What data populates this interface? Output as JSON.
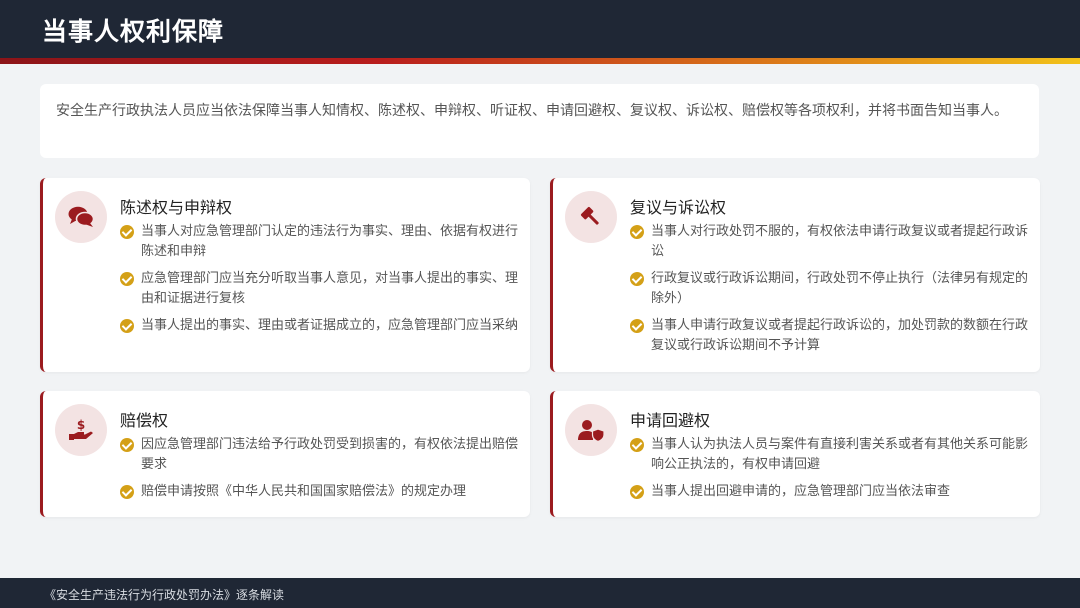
{
  "header": {
    "title": "当事人权利保障"
  },
  "intro": {
    "text": "安全生产行政执法人员应当依法保障当事人知情权、陈述权、申辩权、听证权、申请回避权、复议权、诉讼权、赔偿权等各项权利，并将书面告知当事人。"
  },
  "cards": [
    {
      "icon": "chat-bubbles-icon",
      "title": "陈述权与申辩权",
      "items": [
        "当事人对应急管理部门认定的违法行为事实、理由、依据有权进行陈述和申辩",
        "应急管理部门应当充分听取当事人意见，对当事人提出的事实、理由和证据进行复核",
        "当事人提出的事实、理由或者证据成立的，应急管理部门应当采纳"
      ]
    },
    {
      "icon": "gavel-icon",
      "title": "复议与诉讼权",
      "items": [
        "当事人对行政处罚不服的，有权依法申请行政复议或者提起行政诉讼",
        "行政复议或行政诉讼期间，行政处罚不停止执行（法律另有规定的除外）",
        "当事人申请行政复议或者提起行政诉讼的，加处罚款的数额在行政复议或行政诉讼期间不予计算"
      ]
    },
    {
      "icon": "hand-money-icon",
      "title": "赔偿权",
      "items": [
        "因应急管理部门违法给予行政处罚受到损害的，有权依法提出赔偿要求",
        "赔偿申请按照《中华人民共和国国家赔偿法》的规定办理"
      ]
    },
    {
      "icon": "user-shield-icon",
      "title": "申请回避权",
      "items": [
        "当事人认为执法人员与案件有直接利害关系或者有其他关系可能影响公正执法的，有权申请回避",
        "当事人提出回避申请的，应急管理部门应当依法审查"
      ]
    }
  ],
  "footer": {
    "text": "《安全生产违法行为行政处罚办法》逐条解读"
  },
  "colors": {
    "header_bg": "#1f2735",
    "accent": "#9b1b1f",
    "check": "#d4a017",
    "icon_bg": "#f3e3e3"
  }
}
